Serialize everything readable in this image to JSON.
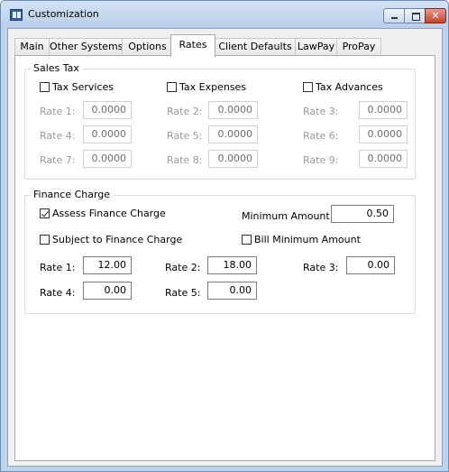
{
  "window": {
    "title": "Customization"
  },
  "tabs": [
    {
      "label": "Main"
    },
    {
      "label": "Other Systems"
    },
    {
      "label": "Options"
    },
    {
      "label": "Rates"
    },
    {
      "label": "Client Defaults"
    },
    {
      "label": "LawPay"
    },
    {
      "label": "ProPay"
    }
  ],
  "active_tab": "Rates",
  "sales_tax": {
    "title": "Sales Tax",
    "checks": [
      {
        "label": "Tax Services",
        "checked": false
      },
      {
        "label": "Tax Expenses",
        "checked": false
      },
      {
        "label": "Tax Advances",
        "checked": false
      }
    ],
    "rates": [
      {
        "label": "Rate 1:",
        "value": "0.0000"
      },
      {
        "label": "Rate 2:",
        "value": "0.0000"
      },
      {
        "label": "Rate 3:",
        "value": "0.0000"
      },
      {
        "label": "Rate 4:",
        "value": "0.0000"
      },
      {
        "label": "Rate 5:",
        "value": "0.0000"
      },
      {
        "label": "Rate 6:",
        "value": "0.0000"
      },
      {
        "label": "Rate 7:",
        "value": "0.0000"
      },
      {
        "label": "Rate 8:",
        "value": "0.0000"
      },
      {
        "label": "Rate 9:",
        "value": "0.0000"
      }
    ]
  },
  "finance_charge": {
    "title": "Finance Charge",
    "assess": {
      "label": "Assess Finance Charge",
      "checked": true
    },
    "subject": {
      "label": "Subject to Finance Charge",
      "checked": false
    },
    "bill_min": {
      "label": "Bill Minimum Amount",
      "checked": false
    },
    "minimum": {
      "label": "Minimum Amount:",
      "value": "0.50"
    },
    "rates": [
      {
        "label": "Rate 1:",
        "value": "12.00"
      },
      {
        "label": "Rate 2:",
        "value": "18.00"
      },
      {
        "label": "Rate 3:",
        "value": "0.00"
      },
      {
        "label": "Rate 4:",
        "value": "0.00"
      },
      {
        "label": "Rate 5:",
        "value": "0.00"
      }
    ]
  }
}
